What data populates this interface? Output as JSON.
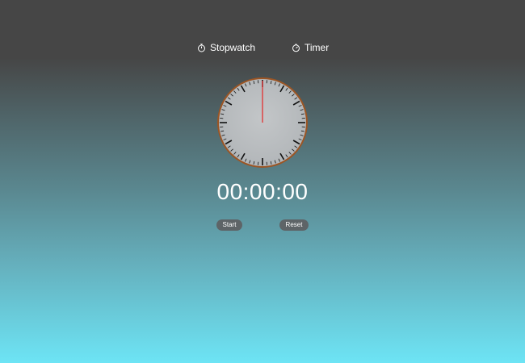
{
  "tabs": {
    "stopwatch": {
      "label": "Stopwatch",
      "icon": "stopwatch-icon"
    },
    "timer": {
      "label": "Timer",
      "icon": "timer-icon"
    }
  },
  "dial": {
    "hand_position_seconds": 0,
    "face_color": "#b8bcbf",
    "rim_color": "#8a4a1a",
    "hand_color": "#e03b3b"
  },
  "display": {
    "time": "00:00:00"
  },
  "buttons": {
    "start_label": "Start",
    "reset_label": "Reset"
  }
}
